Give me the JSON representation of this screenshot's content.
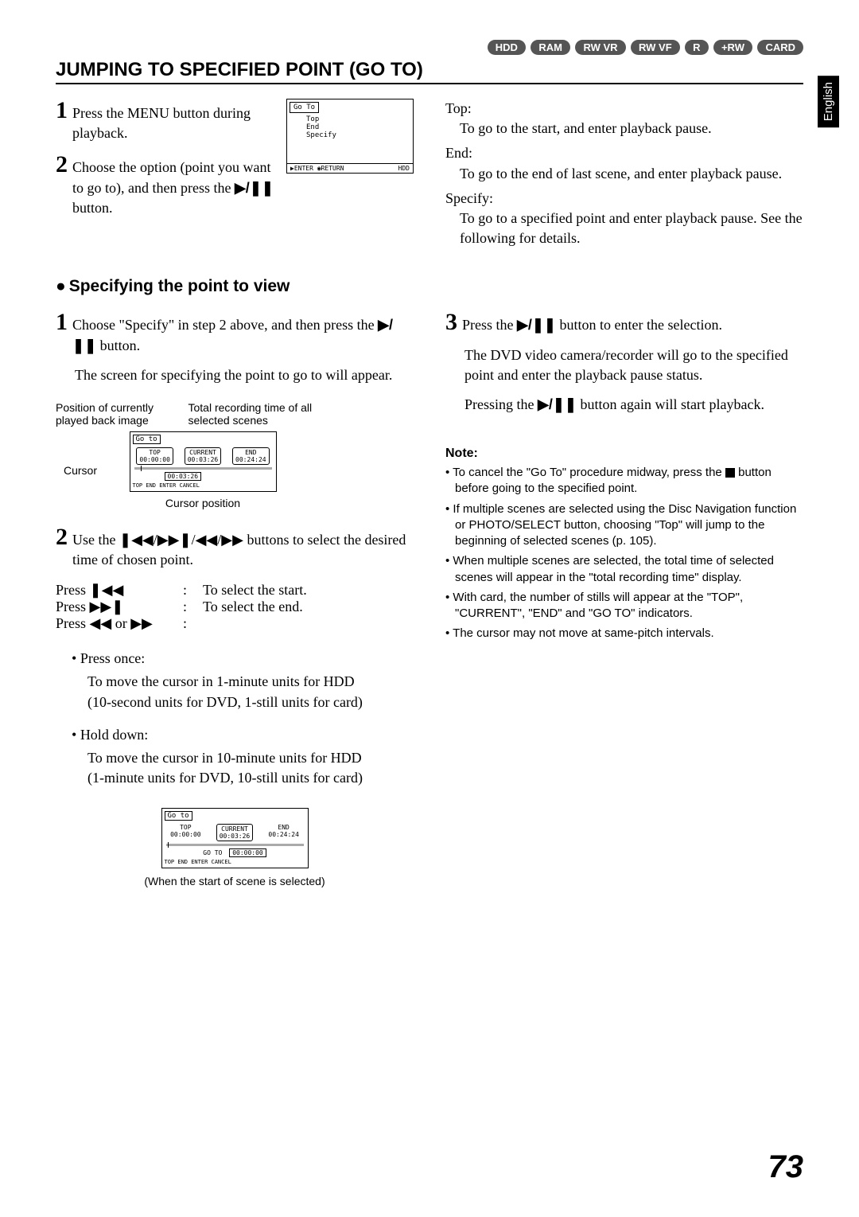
{
  "badges": [
    "HDD",
    "RAM",
    "RW VR",
    "RW VF",
    "R",
    "+RW",
    "CARD"
  ],
  "side_tab": "English",
  "h1": "JUMPING TO SPECIFIED POINT (GO TO)",
  "intro": {
    "step1": "Press the MENU button during playback.",
    "step2_a": "Choose the option (point you want to go to), and then press the ",
    "step2_b": " button."
  },
  "menu1": {
    "title": "Go To",
    "items": [
      "Top",
      "End",
      "Specify"
    ],
    "footer_enter": "ENTER",
    "footer_return": "RETURN",
    "footer_right": "HDD"
  },
  "right_defs": {
    "top_t": "Top:",
    "top_d": "To go to the start, and enter playback pause.",
    "end_t": "End:",
    "end_d": "To go to the end of last scene, and enter playback pause.",
    "spec_t": "Specify:",
    "spec_d": "To go to a specified point and enter playback pause. See the following for details."
  },
  "h2": "Specifying the point to view",
  "spec": {
    "step1_a": "Choose \"Specify\" in step 2 above, and then press the ",
    "step1_b": " button.",
    "step1_sub": "The screen for specifying the point to go to will appear.",
    "diag_left": "Position of currently played back image",
    "diag_right": "Total recording time of all selected scenes",
    "cursor_label": "Cursor",
    "cursor_pos": "Cursor position",
    "goto_title": "Go to",
    "top_cell": "TOP",
    "top_val": "00:00:00",
    "current_cell": "CURRENT",
    "current_val": "00:03:26",
    "end_cell": "END",
    "end_val": "00:24:24",
    "below_val": "00:03:26",
    "goto_footer": "TOP  END  ENTER  CANCEL",
    "step2_a": "Use the ",
    "step2_b": " buttons to select the desired time of chosen point.",
    "press1_k": "Press ",
    "press1_d": "To select the start.",
    "press2_d": "To select the end.",
    "press3_k_a": "Press ",
    "press3_k_b": " or ",
    "press_once": "Press once:",
    "press_once_desc": "To move the cursor in 1-minute units for HDD\n(10-second units for DVD, 1-still units for card)",
    "hold_down": "Hold down:",
    "hold_down_desc": "To move the cursor in 10-minute units for HDD\n(1-minute units for DVD, 10-still units for card)",
    "goto2_title": "Go to",
    "goto2_top": "TOP",
    "goto2_top_v": "00:00:00",
    "goto2_cur": "CURRENT",
    "goto2_cur_v": "00:03:26",
    "goto2_end": "END",
    "goto2_end_v": "00:24:24",
    "goto2_goto_label": "GO TO",
    "goto2_goto_v": "00:00:00",
    "goto2_footer": "TOP  END  ENTER  CANCEL",
    "caption2": "(When the start of scene is selected)"
  },
  "right_col": {
    "step3_a": "Press the ",
    "step3_b": " button to enter the selection.",
    "step3_p1": "The DVD video camera/recorder will go to the specified point and enter the playback pause status.",
    "step3_p2a": "Pressing the ",
    "step3_p2b": " button again will start playback."
  },
  "note": {
    "head": "Note:",
    "items": [
      "To cancel the \"Go To\" procedure midway, press the ■ button before going to the specified point.",
      "If multiple scenes are selected using the Disc Navigation function or PHOTO/SELECT button, choosing \"Top\" will jump to the beginning of selected scenes (p. 105).",
      "When multiple scenes are selected, the total time of selected scenes will appear in the \"total recording time\" display.",
      "With card, the number of stills will appear at the \"TOP\", \"CURRENT\", \"END\" and \"GO TO\" indicators.",
      "The cursor may not move at same-pitch intervals."
    ]
  },
  "page_num": "73"
}
